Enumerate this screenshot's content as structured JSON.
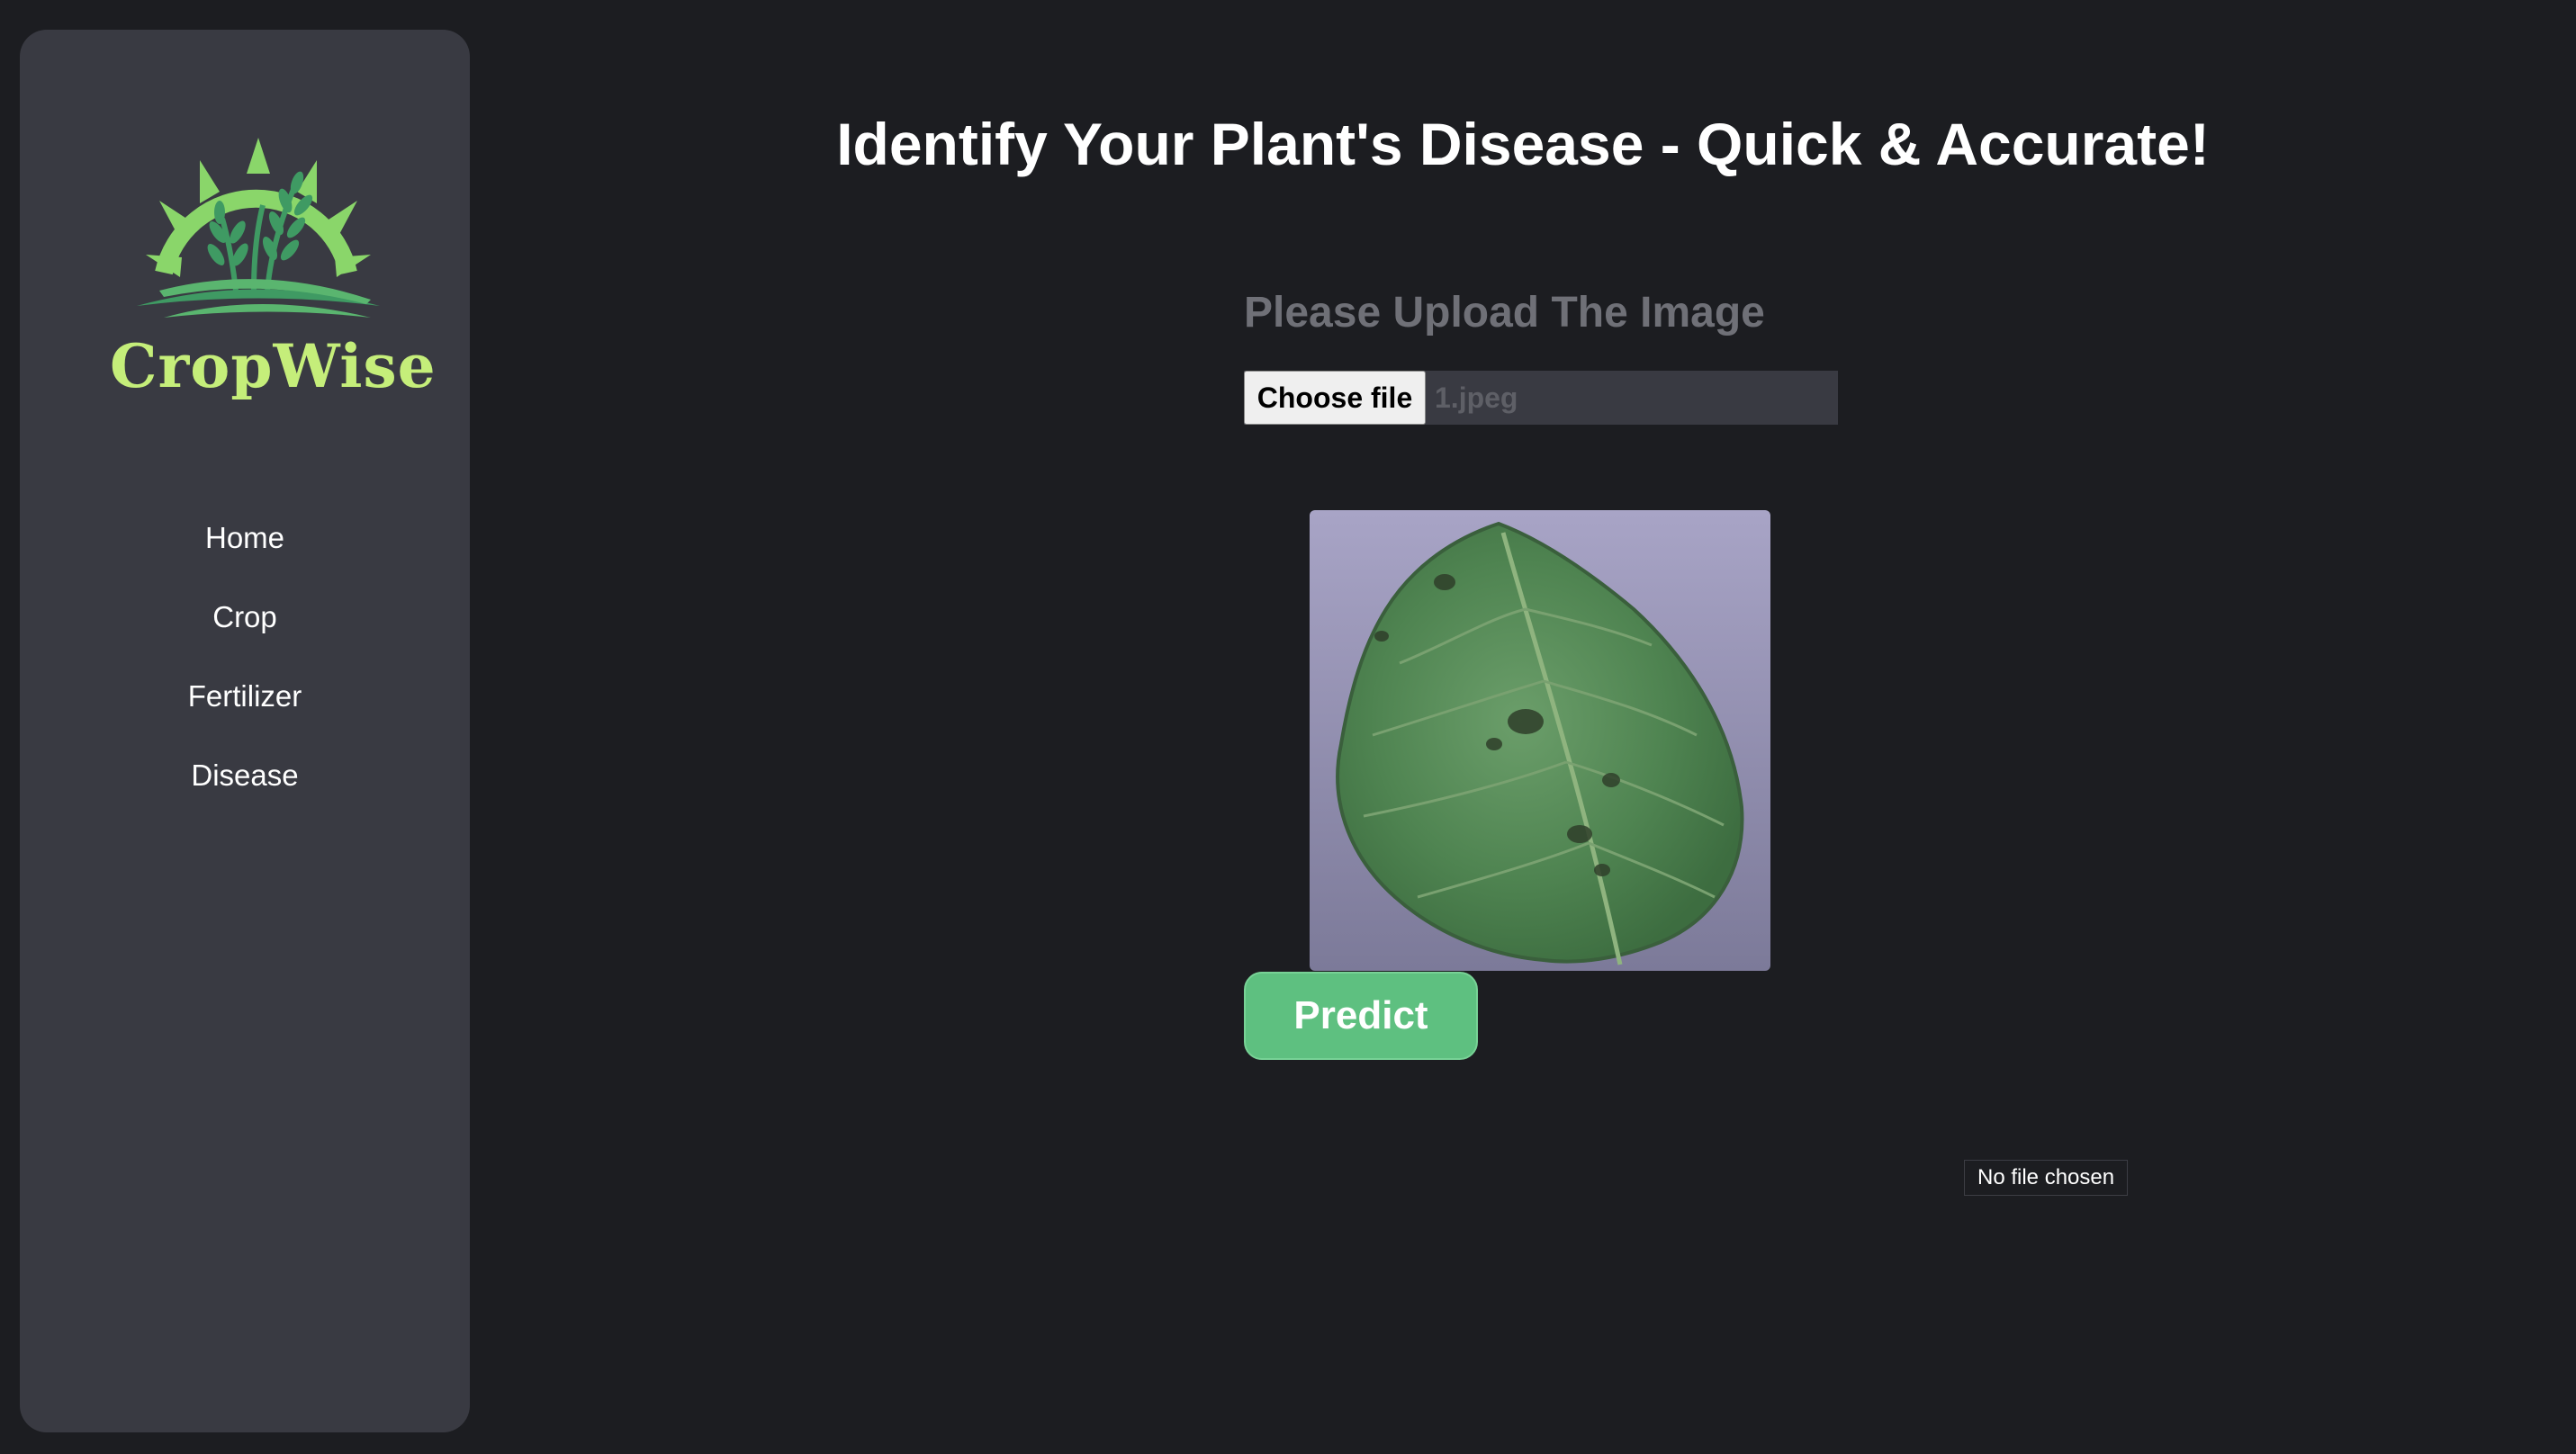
{
  "sidebar": {
    "logo_text": "CropWise",
    "nav": [
      {
        "label": "Home"
      },
      {
        "label": "Crop"
      },
      {
        "label": "Fertilizer"
      },
      {
        "label": "Disease"
      }
    ]
  },
  "main": {
    "title": "Identify Your Plant's Disease - Quick & Accurate!",
    "upload_label": "Please Upload The Image",
    "file_input": {
      "button_label": "Choose file",
      "file_name": "1.jpeg"
    },
    "preview": {
      "icon": "leaf-image"
    },
    "predict_label": "Predict",
    "tooltip": "No file chosen"
  },
  "colors": {
    "background": "#1c1d21",
    "sidebar": "#393a42",
    "accent_green": "#5ec080",
    "logo_text": "#c5ee7a"
  }
}
